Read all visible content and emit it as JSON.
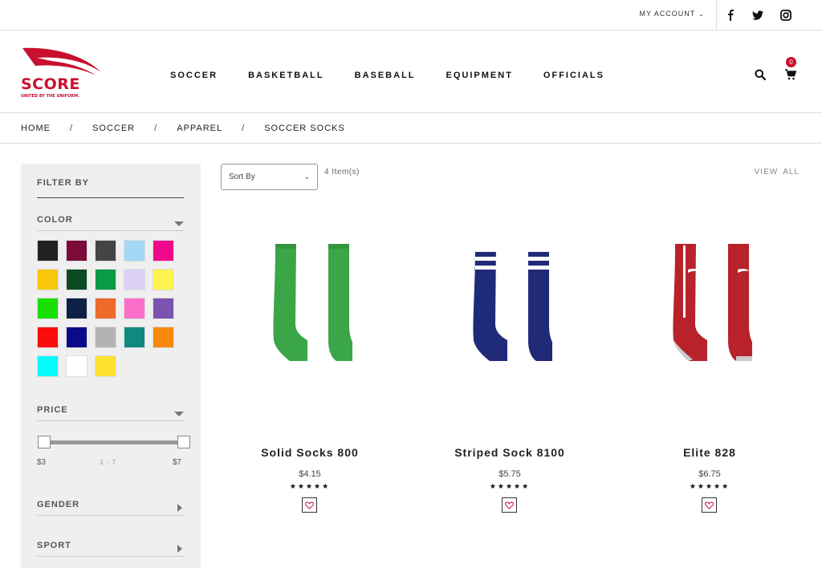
{
  "topbar": {
    "account_label": "MY ACCOUNT",
    "account_chevron": "⌄",
    "social_icons": [
      "facebook-icon",
      "twitter-icon",
      "instagram-icon"
    ]
  },
  "header": {
    "brand_name": "SCORE",
    "tagline": "UNITED BY THE UNIFORM.",
    "brand_color": "#c8102e",
    "nav": [
      {
        "label": "SOCCER"
      },
      {
        "label": "BASKETBALL"
      },
      {
        "label": "BASEBALL"
      },
      {
        "label": "EQUIPMENT"
      },
      {
        "label": "OFFICIALS"
      }
    ],
    "cart_count": "0"
  },
  "breadcrumb": {
    "items": [
      "HOME",
      "SOCCER",
      "APPAREL",
      "SOCCER SOCKS"
    ],
    "separator": "/"
  },
  "sidebar": {
    "filter_title": "FILTER BY",
    "color_title": "COLOR",
    "colors": [
      "#222222",
      "#7b0c3a",
      "#444444",
      "#a3d8f7",
      "#f0078a",
      "#f8c70a",
      "#0c4a23",
      "#0a9b45",
      "#ddd1f3",
      "#fdf34f",
      "#19e000",
      "#0d1f45",
      "#ee6a2a",
      "#fb6fc8",
      "#7a54b0",
      "#fb0d0d",
      "#0b0a8a",
      "#b3b3b5",
      "#0f8a80",
      "#f7890b",
      "#07fafa",
      "#ffffff",
      "#fde232"
    ],
    "price_title": "PRICE",
    "price_min": "$3",
    "price_max": "$7",
    "price_range": "3 - 7",
    "gender_title": "GENDER",
    "sport_title": "SPORT"
  },
  "toolbar": {
    "sort_label": "Sort By",
    "sort_chevron": "⌄",
    "items_count": "4 Item(s)",
    "view_label": "VIEW",
    "all_label": "ALL"
  },
  "products": [
    {
      "name": "Solid Socks 800",
      "price": "$4.15",
      "stars": "★★★★★",
      "color": "#3aa647"
    },
    {
      "name": "Striped Sock 8100",
      "price": "$5.75",
      "stars": "★★★★★",
      "color": "#1f2a78"
    },
    {
      "name": "Elite 828",
      "price": "$6.75",
      "stars": "★★★★★",
      "color": "#b8232a"
    }
  ]
}
